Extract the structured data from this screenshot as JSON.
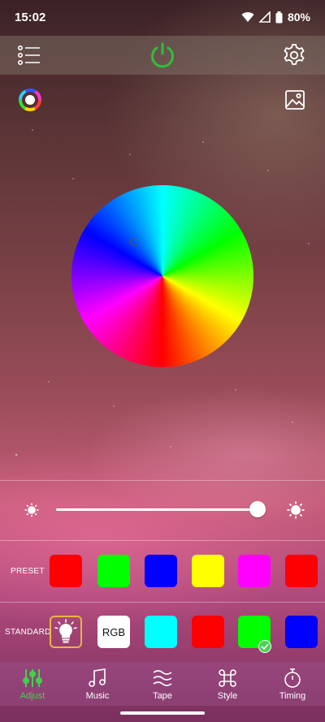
{
  "status_bar": {
    "time": "15:02",
    "battery": "80%",
    "icons": [
      "wifi-icon",
      "signal-icon",
      "battery-icon"
    ]
  },
  "top_bar": {
    "icons": [
      "list-menu-icon",
      "power-icon",
      "settings-icon"
    ],
    "power_color": "#2fbf3a"
  },
  "toolbar": {
    "icons": [
      "color-mode-icon",
      "image-icon"
    ]
  },
  "brightness": {
    "value_percent": 100
  },
  "preset": {
    "label": "PRESET",
    "colors": [
      "#ff0000",
      "#00ff00",
      "#0000ff",
      "#ffff00",
      "#ff00ff",
      "#ff0000"
    ]
  },
  "standard": {
    "label": "STANDARD",
    "rgb_label": "RGB",
    "colors": [
      "#00ffff",
      "#ff0000",
      "#00ff00",
      "#0000ff"
    ],
    "selected_index": 2
  },
  "tabs": [
    {
      "label": "Adjust",
      "icon": "sliders-icon",
      "active": true
    },
    {
      "label": "Music",
      "icon": "music-note-icon",
      "active": false
    },
    {
      "label": "Tape",
      "icon": "tape-icon",
      "active": false
    },
    {
      "label": "Style",
      "icon": "command-icon",
      "active": false
    },
    {
      "label": "Timing",
      "icon": "stopwatch-icon",
      "active": false
    }
  ],
  "colors": {
    "accent": "#3fd34a",
    "bulb_border": "#e8b642"
  }
}
